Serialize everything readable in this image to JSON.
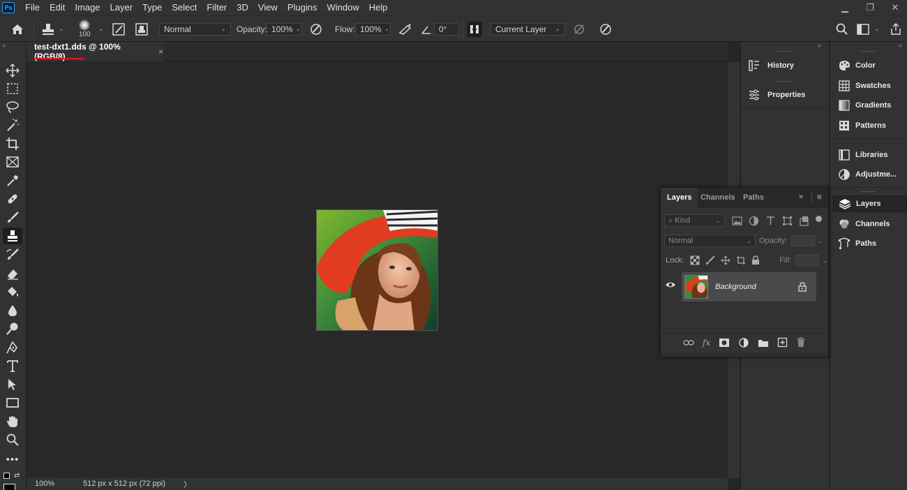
{
  "app": {
    "logo": "Ps"
  },
  "menu": [
    "File",
    "Edit",
    "Image",
    "Layer",
    "Type",
    "Select",
    "Filter",
    "3D",
    "View",
    "Plugins",
    "Window",
    "Help"
  ],
  "options": {
    "brush_size": "100",
    "blend_mode": "Normal",
    "opacity_label": "Opacity:",
    "opacity_value": "100%",
    "flow_label": "Flow:",
    "flow_value": "100%",
    "angle_value": "0°",
    "sample": "Current Layer"
  },
  "document": {
    "tab_title": "test-dxt1.dds @ 100% (RGB/8)",
    "close_glyph": "×"
  },
  "status": {
    "zoom": "100%",
    "doc_info": "512 px x 512 px (72 ppi)",
    "arrow": "〉"
  },
  "mid_panels": [
    "History",
    "Properties"
  ],
  "right_panels": {
    "group1": [
      "Color",
      "Swatches",
      "Gradients",
      "Patterns"
    ],
    "group2": [
      "Libraries",
      "Adjustme..."
    ],
    "group3": [
      "Layers",
      "Channels",
      "Paths"
    ]
  },
  "layers_panel": {
    "tabs": [
      "Layers",
      "Channels",
      "Paths"
    ],
    "kind_placeholder": "Kind",
    "blend_mode": "Normal",
    "opacity_label": "Opacity:",
    "lock_label": "Lock:",
    "fill_label": "Fill:",
    "layer_name": "Background"
  }
}
